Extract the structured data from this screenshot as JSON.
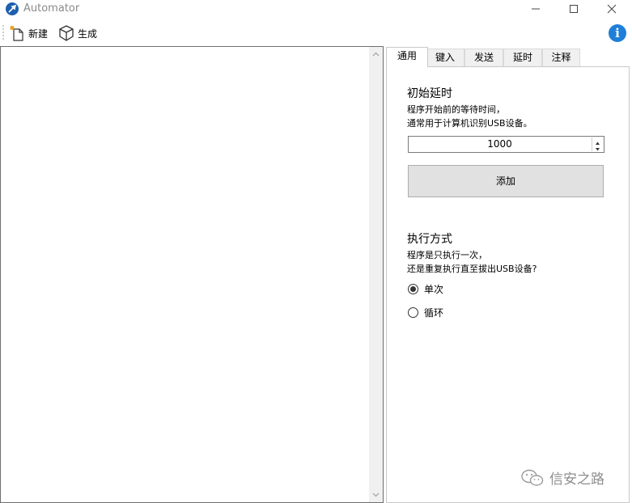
{
  "window": {
    "title": "Automator",
    "controls": [
      "minimize",
      "maximize",
      "close"
    ]
  },
  "toolbar": {
    "new_label": "新建",
    "build_label": "生成"
  },
  "tabs": [
    {
      "label": "通用",
      "active": true
    },
    {
      "label": "键入",
      "active": false
    },
    {
      "label": "发送",
      "active": false
    },
    {
      "label": "延时",
      "active": false
    },
    {
      "label": "注释",
      "active": false
    }
  ],
  "general": {
    "initial_delay_title": "初始延时",
    "initial_delay_desc_1": "程序开始前的等待时间，",
    "initial_delay_desc_2": "通常用于计算机识别USB设备。",
    "delay_value": "1000",
    "add_button_label": "添加",
    "exec_mode_title": "执行方式",
    "exec_mode_desc_1": "程序是只执行一次，",
    "exec_mode_desc_2": "还是重复执行直至拔出USB设备?",
    "options": [
      {
        "label": "单次",
        "selected": true
      },
      {
        "label": "循环",
        "selected": false
      }
    ]
  },
  "watermark": {
    "text": "信安之路"
  },
  "colors": {
    "info_icon": "#1f7fd8",
    "app_icon": "#1e5fae"
  }
}
